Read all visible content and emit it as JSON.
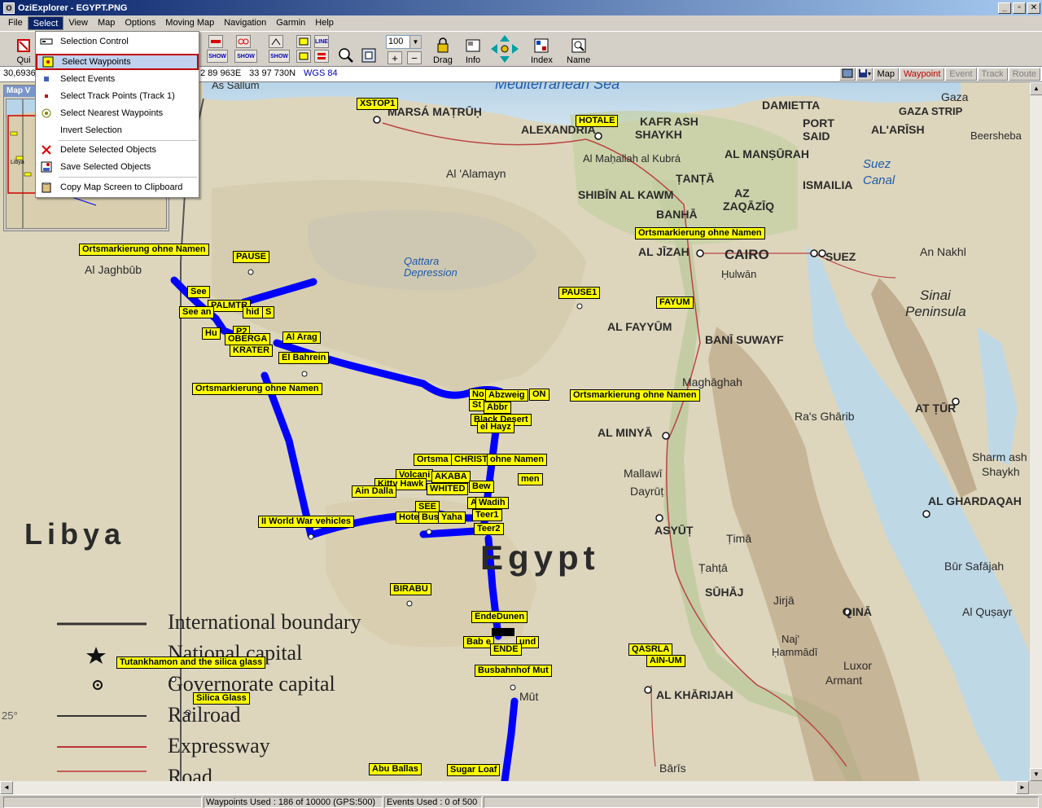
{
  "window": {
    "title": "OziExplorer - EGYPT.PNG",
    "app_icon": "O",
    "buttons": [
      "_",
      "▫",
      "✕"
    ]
  },
  "menubar": [
    "File",
    "Select",
    "View",
    "Map",
    "Options",
    "Moving Map",
    "Navigation",
    "Garmin",
    "Help"
  ],
  "select_menu": {
    "items": [
      {
        "label": "Selection Control",
        "icon": "selection-control-icon"
      },
      {
        "label": "Select Waypoints",
        "icon": "select-waypoints-icon",
        "highlighted": true
      },
      {
        "label": "Select Events",
        "icon": "select-events-icon"
      },
      {
        "label": "Select Track Points (Track 1)",
        "icon": "select-trackpoints-icon"
      },
      {
        "label": "Select Nearest Waypoints",
        "icon": "nearest-waypoints-icon"
      },
      {
        "label": "Invert Selection",
        "icon": ""
      },
      {
        "label": "Delete Selected Objects",
        "icon": "delete-x-icon"
      },
      {
        "label": "Save Selected Objects",
        "icon": "save-objects-icon"
      },
      {
        "label": "Copy Map Screen to Clipboard",
        "icon": "clipboard-icon"
      }
    ]
  },
  "toolbar": {
    "quit_label": "Qui",
    "zoom_value": "100",
    "dropdown_arrow": "▼",
    "zoom_in": "+",
    "zoom_out": "−",
    "drag_label": "Drag",
    "info_label": "Info",
    "index_label": "Index",
    "name_label": "Name",
    "show_label": "SHOW",
    "line_label": "LINE"
  },
  "coordbar": {
    "left": "30,6936",
    "easting": "2 89 963E",
    "northing": "33 97 730N",
    "datum": "WGS 84",
    "layers": {
      "map": "Map",
      "waypoint": "Waypoint",
      "event": "Event",
      "track": "Track",
      "route": "Route"
    }
  },
  "mapview": {
    "title": "Map V",
    "libya_label": "Libya"
  },
  "map_labels": {
    "mediterranean": "Mediterranean Sea",
    "as_sallum": "As Sallum",
    "marsa_matruh": "MARSÁ MAṬRŪḤ",
    "alexandria": "ALEXANDRIA",
    "damietta": "DAMIETTA",
    "kafr": "KAFR ASH",
    "shaykh": "SHAYKH",
    "mahallah": "Al Maḥallah al Kubrá",
    "mansurah": "AL MANṢŪRAH",
    "port_said": "PORT",
    "said": "SAID",
    "gaza": "Gaza",
    "gaza_strip": "GAZA STRIP",
    "al_arish": "AL'ARĪSH",
    "beersheba": "Beersheba",
    "alamayn": "Al 'Alamayn",
    "tanta": "ṬANṬĀ",
    "shibin": "SHIBĪN AL KAWM",
    "az": "AZ",
    "zaqaziq": "ZAQĀZĪQ",
    "ismailia": "ISMAILIA",
    "banha": "BANHĀ",
    "suez_canal1": "Suez",
    "suez_canal2": "Canal",
    "al_jizah": "AL JĪZAH",
    "cairo": "CAIRO",
    "suez": "SUEZ",
    "an_nakhl": "An Nakhl",
    "helwan": "Ḥulwān",
    "jaghbub": "Al Jaghbūb",
    "qattara1": "Qattara",
    "qattara2": "Depression",
    "sinai1": "Sinai",
    "sinai2": "Peninsula",
    "fayyum": "AL FAYYŪM",
    "bani_suwayf": "BANĪ SUWAYF",
    "maghaghah": "Maghāghah",
    "ras_gharib": "Ra's Ghārib",
    "at_tur": "AT ṬŪR",
    "al_minya": "AL MINYĀ",
    "mallawi": "Mallawī",
    "dayrut": "Dayrūṭ",
    "sharm1": "Sharm ash",
    "sharm2": "Shaykh",
    "ghardaqah": "AL GHARDAQAH",
    "libya": "Libya",
    "asyut": "ASYŪṬ",
    "tima": "Ṭimā",
    "egypt": "Egypt",
    "tahta": "Ṭahṭā",
    "sohag": "SŪHĀJ",
    "bur_safajah": "Būr Safājah",
    "jirja": "Jirjā",
    "qina": "QINĀ",
    "qusayr": "Al Quṣayr",
    "naj1": "Naj'",
    "naj2": "Ḥammādī",
    "luxor": "Luxor",
    "armant": "Armant",
    "kharijah": "AL KHĀRIJAH",
    "mut": "Mūt",
    "baris": "Bārīs",
    "deg25": "25°",
    "int_boundary": "International boundary",
    "nat_capital": "National capital",
    "gov_capital": "Governorate capital",
    "railroad": "Railroad",
    "expressway": "Expressway",
    "road": "Road"
  },
  "waypoints": [
    "XSTOP1",
    "HOTALE",
    "Ortsmarkierung ohne Namen",
    "PAUSE",
    "Ortsmarkierung ohne Namen",
    "See",
    "PALMTR",
    "See an",
    "hid",
    "S",
    "Hu",
    "P2",
    "OBERGA",
    "KRATER",
    "Al Arag",
    "El Bahrein",
    "Ortsmarkierung ohne Namen",
    "PAUSE1",
    "FAYUM",
    "Ortsmarkierung ohne Namen",
    "No",
    "Abzweig",
    "ON",
    "St",
    "Abbr",
    "Black Desert",
    "el Hayz",
    "Ortsma",
    "CHRIST",
    "ohne Namen",
    "Volcani",
    "AKABA",
    "men",
    "Kitty Hawk",
    "Ain Dalla",
    "WHITED",
    "Bew",
    "SEE",
    "A",
    "Wadih",
    "Hote",
    "Bus",
    "Yaha",
    "Teer1",
    "II World War vehicles",
    "Teer2",
    "BIRABU",
    "EndeDunen",
    "Bab e",
    "und",
    "ENDE",
    "QASRLA",
    "AIN-UM",
    "Tutankhamon and the silica glass",
    "Busbahnhof Mut",
    "Silica Glass",
    "Abu Ballas",
    "Sugar Loaf"
  ],
  "statusbar": {
    "waypoints_used": "Waypoints Used : 186 of 10000  (GPS:500)",
    "events_used": "Events Used : 0 of 500"
  },
  "colors": {
    "track": "#0000ff",
    "waypoint_bg": "#ffff00",
    "menu_highlight": "#c1d2ee",
    "highlight_border": "#c00000"
  }
}
